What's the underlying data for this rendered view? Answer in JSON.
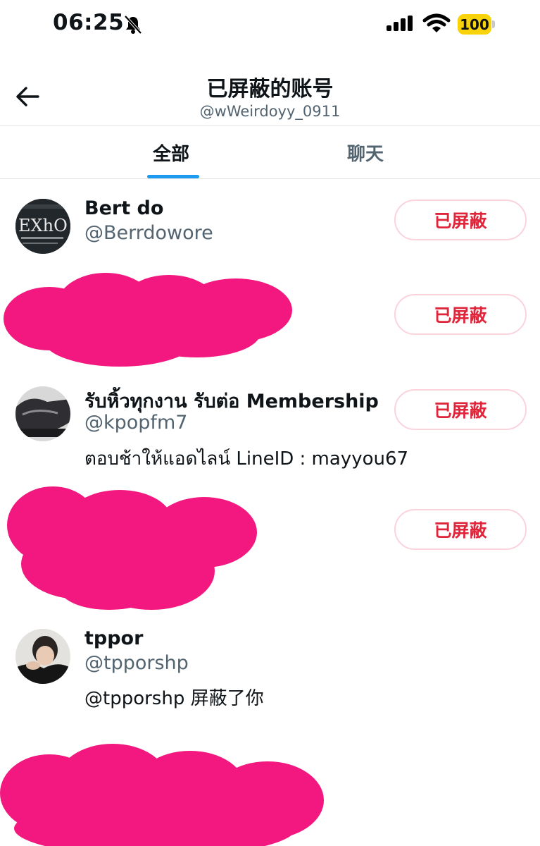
{
  "status_bar": {
    "time": "06:25",
    "battery": "100",
    "icons": [
      "bell-muted-icon",
      "signal-icon",
      "wifi-icon",
      "battery-icon"
    ]
  },
  "header": {
    "title": "已屏蔽的账号",
    "subtitle": "@wWeirdoyy_0911"
  },
  "tabs": [
    {
      "label": "全部",
      "active": true
    },
    {
      "label": "聊天",
      "active": false
    }
  ],
  "accounts": [
    {
      "name": "Bert do",
      "handle": "@Berrdowore",
      "button": "已屏蔽"
    },
    {
      "redacted": true,
      "button": "已屏蔽"
    },
    {
      "name": "รับหิ้วทุกงาน รับต่อ Membership",
      "handle": "@kpopfm7",
      "bio": "ตอบช้าให้แอดไลน์ LineID : mayyou67",
      "button": "已屏蔽"
    },
    {
      "redacted": true,
      "button": "已屏蔽"
    },
    {
      "name": "tppor",
      "handle": "@tpporshp",
      "bio": "@tpporshp 屏蔽了你"
    },
    {
      "redacted": true
    }
  ],
  "colors": {
    "accent": "#1d9bf0",
    "blocked_text": "#e0243a",
    "blocked_border": "#fbd3dc",
    "redaction": "#f2187f",
    "muted_text": "#536471"
  }
}
